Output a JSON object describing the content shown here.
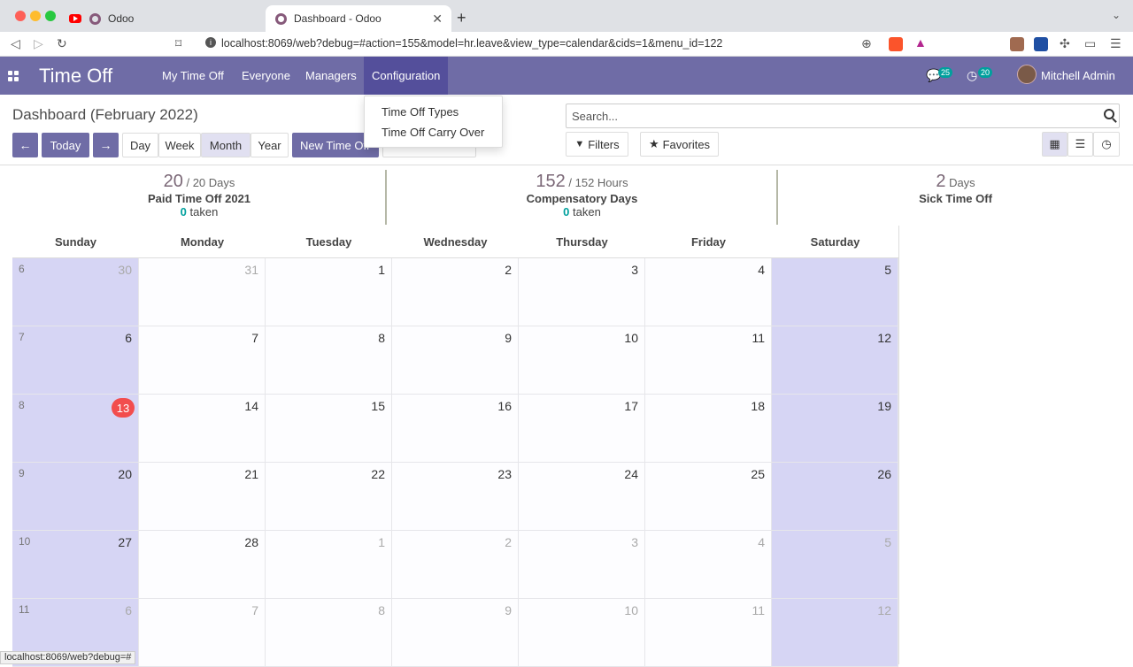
{
  "browser": {
    "tabs": [
      {
        "title": "Odoo"
      },
      {
        "title": "Dashboard - Odoo"
      }
    ],
    "url": "localhost:8069/web?debug=#action=155&model=hr.leave&view_type=calendar&cids=1&menu_id=122",
    "status_text": "localhost:8069/web?debug=#"
  },
  "navbar": {
    "brand": "Time Off",
    "menus": [
      "My Time Off",
      "Everyone",
      "Managers",
      "Configuration"
    ],
    "messages_count": "25",
    "activities_count": "20",
    "user": "Mitchell Admin"
  },
  "config_dropdown": {
    "items": [
      "Time Off Types",
      "Time Off Carry Over"
    ]
  },
  "page": {
    "title": "Dashboard (February 2022)",
    "today_label": "Today",
    "view_modes": [
      "Day",
      "Week",
      "Month",
      "Year"
    ],
    "active_mode": "Month",
    "new_button": "New Time Off",
    "search_placeholder": "Search...",
    "filters_label": "Filters",
    "favorites_label": "Favorites"
  },
  "summary": [
    {
      "value": "20",
      "total": "/ 20 Days",
      "name": "Paid Time Off 2021",
      "taken": "0",
      "taken_label": "taken"
    },
    {
      "value": "152",
      "total": "/ 152 Hours",
      "name": "Compensatory Days",
      "taken": "0",
      "taken_label": "taken"
    },
    {
      "value": "2",
      "total": "Days",
      "name": "Sick Time Off"
    }
  ],
  "calendar": {
    "weekdays": [
      "Sunday",
      "Monday",
      "Tuesday",
      "Wednesday",
      "Thursday",
      "Friday",
      "Saturday"
    ],
    "weeks": [
      {
        "week": "6",
        "days": [
          {
            "d": "30",
            "m": true
          },
          {
            "d": "31",
            "m": true
          },
          {
            "d": "1"
          },
          {
            "d": "2"
          },
          {
            "d": "3"
          },
          {
            "d": "4"
          },
          {
            "d": "5"
          }
        ]
      },
      {
        "week": "7",
        "days": [
          {
            "d": "6"
          },
          {
            "d": "7"
          },
          {
            "d": "8"
          },
          {
            "d": "9"
          },
          {
            "d": "10"
          },
          {
            "d": "11"
          },
          {
            "d": "12"
          }
        ]
      },
      {
        "week": "8",
        "days": [
          {
            "d": "13",
            "today": true
          },
          {
            "d": "14"
          },
          {
            "d": "15"
          },
          {
            "d": "16"
          },
          {
            "d": "17"
          },
          {
            "d": "18"
          },
          {
            "d": "19"
          }
        ]
      },
      {
        "week": "9",
        "days": [
          {
            "d": "20"
          },
          {
            "d": "21"
          },
          {
            "d": "22"
          },
          {
            "d": "23"
          },
          {
            "d": "24"
          },
          {
            "d": "25"
          },
          {
            "d": "26"
          }
        ]
      },
      {
        "week": "10",
        "days": [
          {
            "d": "27"
          },
          {
            "d": "28"
          },
          {
            "d": "1",
            "m": true
          },
          {
            "d": "2",
            "m": true
          },
          {
            "d": "3",
            "m": true
          },
          {
            "d": "4",
            "m": true
          },
          {
            "d": "5",
            "m": true
          }
        ]
      },
      {
        "week": "11",
        "days": [
          {
            "d": "6",
            "m": true
          },
          {
            "d": "7",
            "m": true
          },
          {
            "d": "8",
            "m": true
          },
          {
            "d": "9",
            "m": true
          },
          {
            "d": "10",
            "m": true
          },
          {
            "d": "11",
            "m": true
          },
          {
            "d": "12",
            "m": true
          }
        ]
      }
    ]
  }
}
